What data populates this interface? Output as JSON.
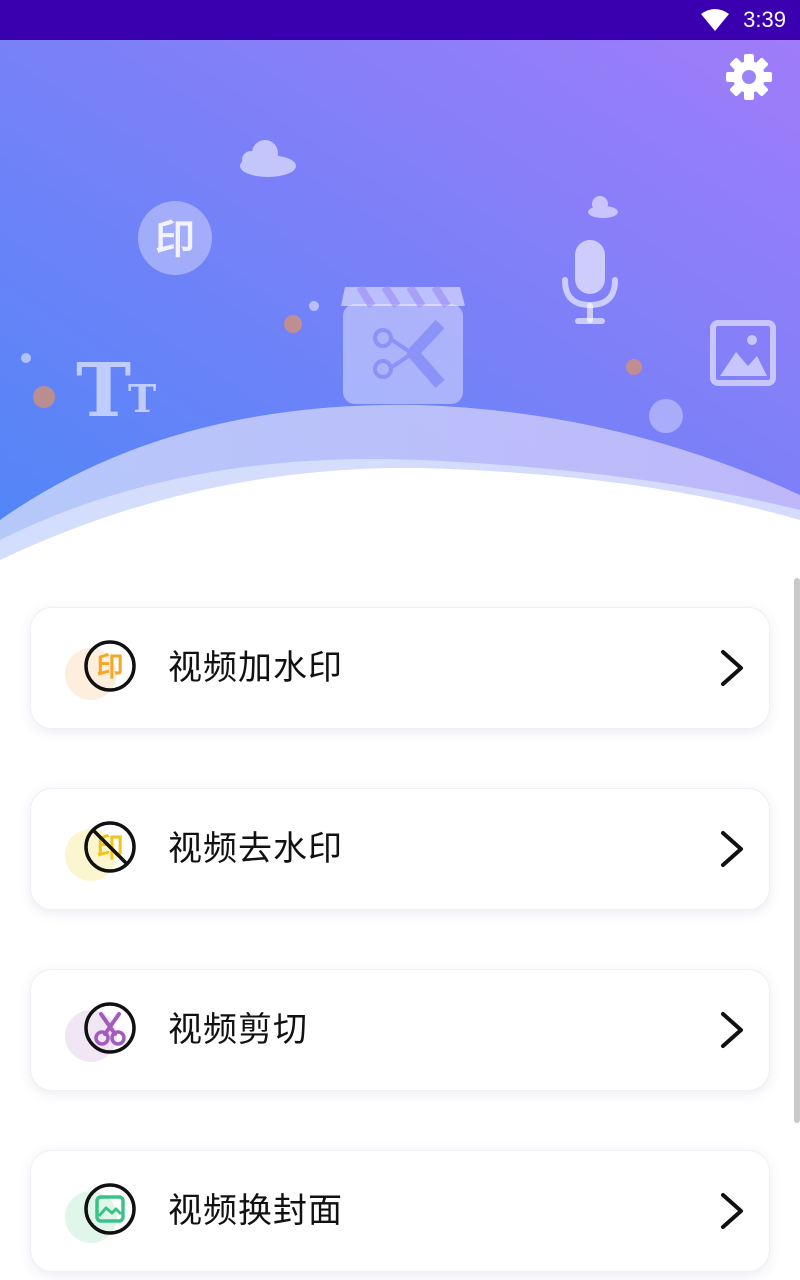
{
  "status_bar": {
    "time": "3:39",
    "wifi_icon": "wifi-icon"
  },
  "header": {
    "settings_icon": "gear-icon",
    "illustration_glyphs": {
      "watermark_badge": "印",
      "text_tool": "T",
      "text_tool_small": "T"
    }
  },
  "menu": {
    "items": [
      {
        "label": "视频加水印",
        "icon": "watermark-add-icon",
        "icon_glyph": "印",
        "accent": "#f5a623",
        "blob": "#fdeedd"
      },
      {
        "label": "视频去水印",
        "icon": "watermark-remove-icon",
        "icon_glyph": "印",
        "accent": "#f0c419",
        "blob": "#fbf6cf"
      },
      {
        "label": "视频剪切",
        "icon": "scissors-icon",
        "accent": "#a35bbf",
        "blob": "#f1e6f3"
      },
      {
        "label": "视频换封面",
        "icon": "image-cover-icon",
        "accent": "#39c387",
        "blob": "#e0f6ea"
      }
    ],
    "chevron_icon": "chevron-right-icon"
  },
  "colors": {
    "status_bar": "#3a00b0",
    "gradient_start": "#4f86f7",
    "gradient_end": "#9a7cf8"
  }
}
